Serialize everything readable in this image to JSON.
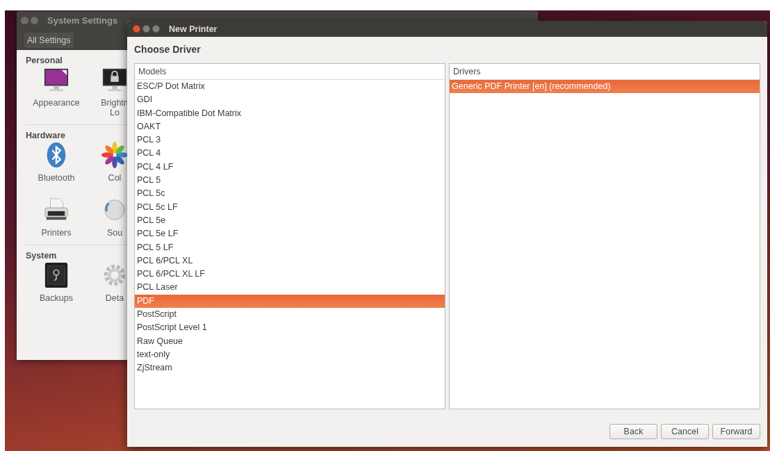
{
  "settings_window": {
    "title": "System Settings",
    "toolbar_button": "All Settings",
    "sections": [
      {
        "title": "Personal",
        "items": [
          {
            "kind": "appearance",
            "label": "Appearance"
          },
          {
            "kind": "brightness",
            "label": "Brightn",
            "label_2": "Lo"
          }
        ]
      },
      {
        "title": "Hardware",
        "items": [
          {
            "kind": "bluetooth",
            "label": "Bluetooth"
          },
          {
            "kind": "color",
            "label": "Col"
          },
          {
            "kind": "printer",
            "label": "Printers"
          },
          {
            "kind": "sound",
            "label": "Sou"
          }
        ]
      },
      {
        "title": "System",
        "items": [
          {
            "kind": "backups",
            "label": "Backups"
          },
          {
            "kind": "details",
            "label": "Deta"
          }
        ]
      }
    ]
  },
  "dialog": {
    "title": "New Printer",
    "heading": "Choose Driver",
    "models": {
      "header": "Models",
      "rows": [
        {
          "label": "ESC/P Dot Matrix",
          "selected": false
        },
        {
          "label": "GDI",
          "selected": false
        },
        {
          "label": "IBM-Compatible Dot Matrix",
          "selected": false
        },
        {
          "label": "OAKT",
          "selected": false
        },
        {
          "label": "PCL 3",
          "selected": false
        },
        {
          "label": "PCL 4",
          "selected": false
        },
        {
          "label": "PCL 4 LF",
          "selected": false
        },
        {
          "label": "PCL 5",
          "selected": false
        },
        {
          "label": "PCL 5c",
          "selected": false
        },
        {
          "label": "PCL 5c LF",
          "selected": false
        },
        {
          "label": "PCL 5e",
          "selected": false
        },
        {
          "label": "PCL 5e LF",
          "selected": false
        },
        {
          "label": "PCL 5 LF",
          "selected": false
        },
        {
          "label": "PCL 6/PCL XL",
          "selected": false
        },
        {
          "label": "PCL 6/PCL XL LF",
          "selected": false
        },
        {
          "label": "PCL Laser",
          "selected": false
        },
        {
          "label": "PDF",
          "selected": true
        },
        {
          "label": "PostScript",
          "selected": false
        },
        {
          "label": "PostScript Level 1",
          "selected": false
        },
        {
          "label": "Raw Queue",
          "selected": false
        },
        {
          "label": "text-only",
          "selected": false
        },
        {
          "label": "ZjStream",
          "selected": false
        }
      ]
    },
    "drivers": {
      "header": "Drivers",
      "rows": [
        {
          "label": "Generic PDF Printer [en] (recommended)",
          "selected": true
        }
      ]
    },
    "buttons": [
      "Back",
      "Cancel",
      "Forward"
    ]
  }
}
